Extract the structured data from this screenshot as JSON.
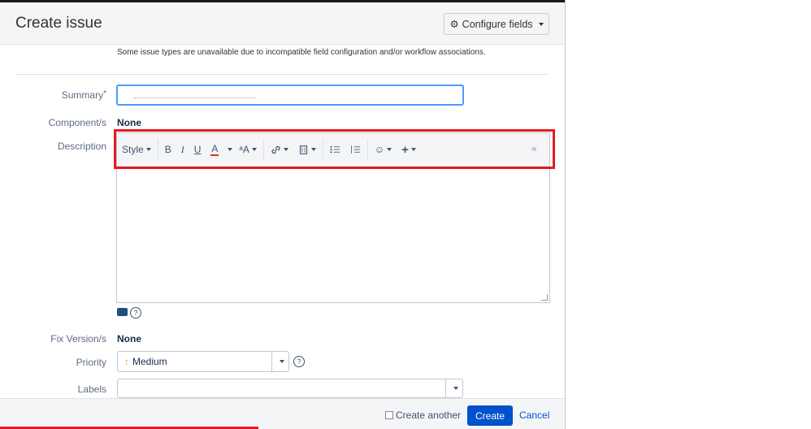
{
  "dialog": {
    "title": "Create issue",
    "configure_fields_label": "Configure fields",
    "notice": "Some issue types are unavailable due to incompatible field configuration and/or workflow associations."
  },
  "fields": {
    "summary_label": "Summary",
    "summary_required_mark": "*",
    "summary_value": "",
    "component_label": "Component/s",
    "component_value": "None",
    "description_label": "Description",
    "fix_version_label": "Fix Version/s",
    "fix_version_value": "None",
    "priority_label": "Priority",
    "priority_value": "Medium",
    "labels_label": "Labels",
    "labels_value": ""
  },
  "toolbar": {
    "style_label": "Style",
    "bold": "B",
    "italic": "I",
    "underline": "U",
    "font_color": "A",
    "text_effects": "ᵃA",
    "link": "🔗",
    "attachment": "▥",
    "bullet_list": "☰",
    "numbered_list": "☰",
    "emoticon": "☺",
    "insert_more": "+",
    "collapse": "≈"
  },
  "footer": {
    "create_another_label": "Create another",
    "create_another_checked": false,
    "create_button": "Create",
    "cancel_link": "Cancel"
  },
  "icons": {
    "gear": "gear-icon",
    "help": "help-icon",
    "priority_arrow": "arrow-up-icon",
    "wiki": "wiki-markup-icon"
  },
  "colors": {
    "accent": "#0052cc",
    "highlight_border": "#e31b23",
    "priority_medium": "#ff8b00",
    "focus_border": "#4c9aff"
  }
}
